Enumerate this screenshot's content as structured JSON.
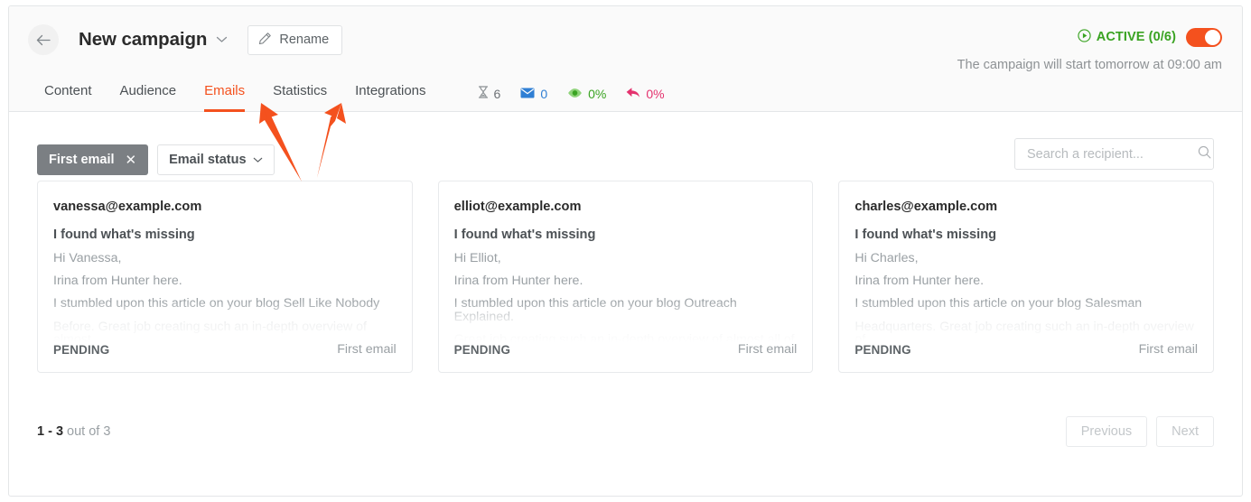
{
  "header": {
    "back_icon": "arrow-left-icon",
    "campaign_title": "New campaign",
    "title_caret_icon": "chevron-down-icon",
    "rename_label": "Rename",
    "rename_icon": "pencil-icon",
    "status_text": "ACTIVE (0/6)",
    "status_icon": "play-circle-icon",
    "status_color": "#3aa322",
    "toggle_state": "on",
    "toggle_color": "#f4511e",
    "schedule_note": "The campaign will start tomorrow at 09:00 am"
  },
  "tabs": [
    {
      "label": "Content",
      "active": false
    },
    {
      "label": "Audience",
      "active": false
    },
    {
      "label": "Emails",
      "active": true
    },
    {
      "label": "Statistics",
      "active": false
    },
    {
      "label": "Integrations",
      "active": false
    }
  ],
  "metrics": [
    {
      "icon": "hourglass-icon",
      "value": "6",
      "kind": "pending",
      "color": "#6d7276"
    },
    {
      "icon": "envelope-icon",
      "value": "0",
      "kind": "sent",
      "color": "#2f7fd4"
    },
    {
      "icon": "eye-icon",
      "value": "0%",
      "kind": "opened",
      "color": "#3aa322"
    },
    {
      "icon": "reply-arrow-icon",
      "value": "0%",
      "kind": "replied",
      "color": "#e4326e"
    }
  ],
  "filters": {
    "chip_label": "First email",
    "chip_remove_icon": "close-icon",
    "status_dropdown_label": "Email status",
    "status_dropdown_icon": "chevron-down-icon"
  },
  "search": {
    "placeholder": "Search a recipient...",
    "value": "",
    "icon": "search-icon"
  },
  "cards": [
    {
      "email": "vanessa@example.com",
      "subject": "I found what's missing",
      "line1": "Hi Vanessa,",
      "line2": "Irina from Hunter here.",
      "line3": "I stumbled upon this article on your blog Sell Like Nobody",
      "line4": "Before. Great job creating such an in-depth overview of almost",
      "status": "PENDING",
      "step": "First email"
    },
    {
      "email": "elliot@example.com",
      "subject": "I found what's missing",
      "line1": "Hi Elliot,",
      "line2": "Irina from Hunter here.",
      "line3": "I stumbled upon this article on your blog Outreach Explained.",
      "line4": "Great job creating such an in-depth overview of almost all of",
      "status": "PENDING",
      "step": "First email"
    },
    {
      "email": "charles@example.com",
      "subject": "I found what's missing",
      "line1": "Hi Charles,",
      "line2": "Irina from Hunter here.",
      "line3": "I stumbled upon this article on your blog Salesman",
      "line4": "Headquarters. Great job creating such an in-depth overview of",
      "status": "PENDING",
      "step": "First email"
    }
  ],
  "pagination": {
    "range": "1 - 3",
    "suffix": " out of 3",
    "previous_label": "Previous",
    "next_label": "Next"
  },
  "annotations": {
    "arrow_color": "#f4511e",
    "arrow_left_target": "Statistics",
    "arrow_right_target": "Integrations"
  }
}
